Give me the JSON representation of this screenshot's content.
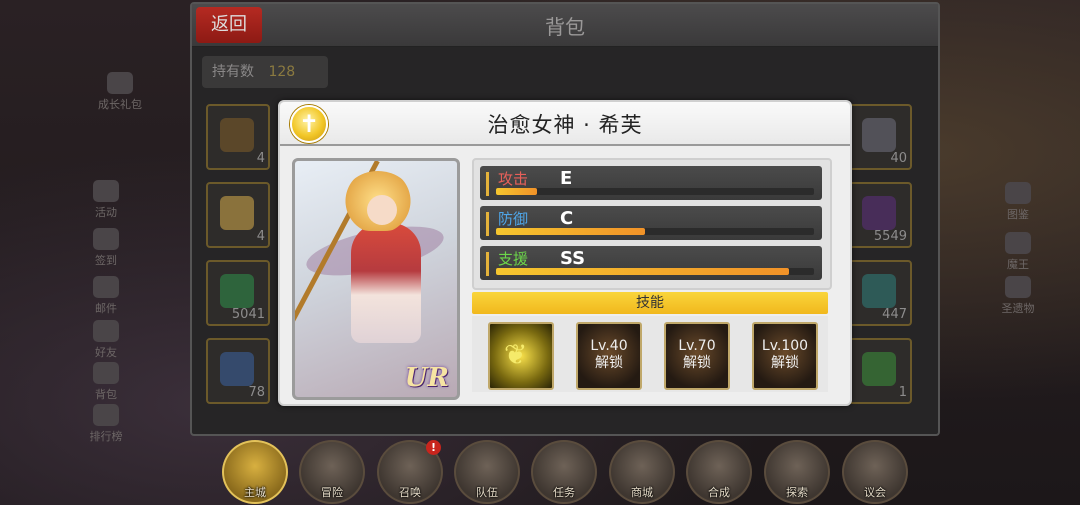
{
  "bag": {
    "back_label": "返回",
    "title": "背包",
    "owned_label": "持有数",
    "owned_value": "128",
    "left_counts": [
      "4",
      "4",
      "5041",
      "78"
    ],
    "right_counts": [
      "40",
      "5549",
      "447",
      "1"
    ]
  },
  "side": {
    "left": [
      "成长礼包",
      "活动",
      "签到",
      "邮件",
      "好友",
      "背包",
      "排行榜"
    ],
    "right": [
      "图鉴",
      "魔王",
      "圣遗物"
    ]
  },
  "nav": {
    "items": [
      "主城",
      "冒险",
      "召唤",
      "队伍",
      "任务",
      "商城",
      "合成",
      "探索",
      "议会"
    ],
    "summon_badge": "!"
  },
  "popup": {
    "name": "治愈女神 · 希芙",
    "rarity": "UR",
    "class_icon": "holy-cross-icon",
    "stats": [
      {
        "label": "攻击",
        "grade": "E",
        "fill": 0.13,
        "color": "#e8605a"
      },
      {
        "label": "防御",
        "grade": "C",
        "fill": 0.47,
        "color": "#4fa6e8"
      },
      {
        "label": "支援",
        "grade": "SS",
        "fill": 0.92,
        "color": "#6cd64a"
      }
    ],
    "skills_title": "技能",
    "skills": [
      {
        "lv": "",
        "lock": "",
        "unlocked": true
      },
      {
        "lv": "Lv.40",
        "lock": "解锁",
        "unlocked": false
      },
      {
        "lv": "Lv.70",
        "lock": "解锁",
        "unlocked": false
      },
      {
        "lv": "Lv.100",
        "lock": "解锁",
        "unlocked": false
      }
    ]
  }
}
